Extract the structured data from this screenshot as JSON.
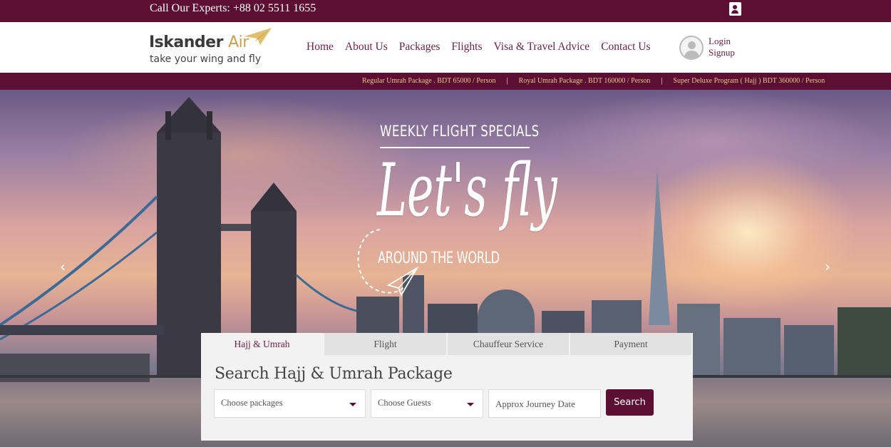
{
  "topbar": {
    "phone_text": "Call Our Experts: +88 02 5511 1655",
    "contact_icon": "address-book-icon"
  },
  "header": {
    "logo_brand": "Iskander",
    "logo_brand_accent": "Air",
    "logo_tagline": "take your wing and fly",
    "nav": [
      {
        "label": "Home"
      },
      {
        "label": "About Us"
      },
      {
        "label": "Packages"
      },
      {
        "label": "Flights"
      },
      {
        "label": "Visa & Travel Advice"
      },
      {
        "label": "Contact Us"
      }
    ],
    "account": {
      "login_label": "Login",
      "signup_label": "Signup"
    }
  },
  "ticker": {
    "items": [
      "Regular Umrah Package . BDT 65000 / Person",
      "Royal Umrah Package . BDT 160000 / Person",
      "Super Deluxe Program ( Hajj ) BDT 360000 / Person"
    ],
    "separator": "|"
  },
  "hero": {
    "kicker": "WEEKLY FLIGHT SPECIALS",
    "headline": "Let's fly",
    "subline": "AROUND THE WORLD",
    "prev_arrow": "‹",
    "next_arrow": "›"
  },
  "search": {
    "tabs": [
      {
        "label": "Hajj & Umrah",
        "active": true
      },
      {
        "label": "Flight",
        "active": false
      },
      {
        "label": "Chauffeur Service",
        "active": false
      },
      {
        "label": "Payment",
        "active": false
      }
    ],
    "heading": "Search Hajj & Umrah Package",
    "packages_select": "Choose packages",
    "guests_select": "Choose Guests",
    "date_placeholder": "Approx Journey Date",
    "search_button": "Search"
  },
  "colors": {
    "brand": "#5c0e33",
    "accent_gold": "#c6a24e",
    "ticker_text": "#e8c98a"
  }
}
